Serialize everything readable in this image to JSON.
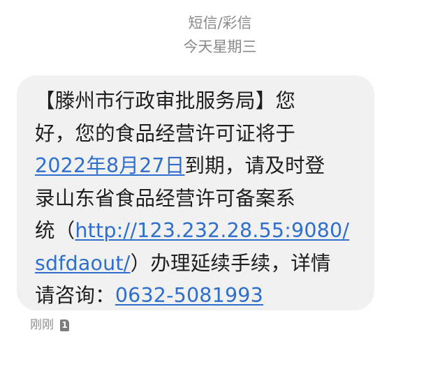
{
  "header": {
    "message_type": "短信/彩信",
    "date": "今天星期三"
  },
  "message": {
    "line1": "【滕州市行政审批服务局】您",
    "line2": "好，您的食品经营许可证将于",
    "expiry_date_link": "2022年8月27日",
    "line3_rest": "到期，请及时登",
    "line4": "录山东省食品经营许可备案系",
    "line5_prefix": "统（",
    "url_part1": "http://123.232.28.55:9080/",
    "url_part2": "sdfdaout/",
    "line6_rest": "）办理延续手续，详情",
    "line7_prefix": "请咨询：",
    "phone_link": "0632-5081993"
  },
  "footer": {
    "time": "刚刚",
    "sim_badge": "1"
  }
}
